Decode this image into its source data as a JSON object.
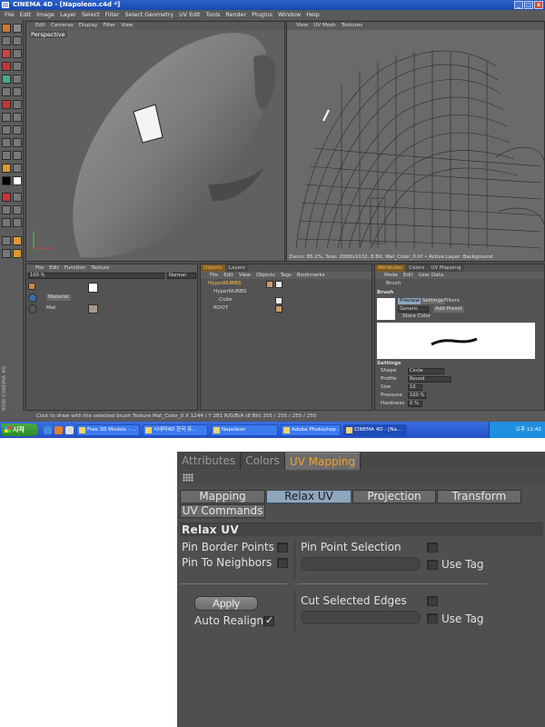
{
  "window": {
    "title": "CINEMA 4D - [Napoleon.c4d *]",
    "controls": [
      "_",
      "□",
      "x"
    ]
  },
  "menubar": [
    "File",
    "Edit",
    "Image",
    "Layer",
    "Select",
    "Filter",
    "Select Geometry",
    "UV Edit",
    "Tools",
    "Render",
    "Plugins",
    "Window",
    "Help"
  ],
  "viewport_left": {
    "menu": [
      "Edit",
      "Cameras",
      "Display",
      "Filter",
      "View"
    ],
    "label": "Perspective"
  },
  "viewport_right": {
    "menu": [
      "View",
      "UV Mesh",
      "Textures"
    ],
    "status": "Zoom: 85.2%, Size: 2080x1032, 8 Bit, Mat_Color_0.tif • Active Layer: Background"
  },
  "material_panel": {
    "menu": [
      "File",
      "Edit",
      "Function",
      "Texture"
    ],
    "zoom_value": "100 %",
    "blend_mode": "Normal",
    "materials": [
      "Material",
      "Mat"
    ]
  },
  "objects_panel": {
    "tabs": [
      "Objects",
      "Layers"
    ],
    "menu": [
      "File",
      "Edit",
      "View",
      "Objects",
      "Tags",
      "Bookmarks"
    ],
    "objects": [
      "HyperNURBS",
      "HyperNURBS",
      "Cube",
      "ROOT"
    ]
  },
  "attr_panel": {
    "tabs": [
      "Attributes",
      "Colors",
      "UV Mapping"
    ],
    "menu": [
      "Mode",
      "Edit",
      "User Data"
    ],
    "tool_name": "Brush",
    "section": "Brush",
    "preset_tabs": [
      "Preview",
      "Settings",
      "Filters"
    ],
    "preset_value": "Generic",
    "add_preset": "Add Preset",
    "store_color": "Store Color",
    "settings_header": "Settings",
    "shape_label": "Shape",
    "shape_value": "Circle",
    "profile_label": "Profile",
    "profile_value": "Round",
    "size_label": "Size",
    "size_value": "10",
    "pressure_label": "Pressure",
    "pressure_value": "100 %",
    "hardness_label": "Hardness",
    "hardness_value": "0 %"
  },
  "statusbar": {
    "text": "Click to draw with the selected brush  Texture Mat_Color_0   X 1244 / Y 281 R/G/B/A (8 Bit) 255 / 255 / 255 / 255"
  },
  "taskbar": {
    "start": "시작",
    "tasks": [
      "Free 3D Models - ...",
      "시네마4D 한국 유...",
      "Napoleon",
      "Adobe Photoshop ...",
      "CINEMA 4D - [Na..."
    ],
    "clock": "오후 12:42"
  },
  "uv_panel": {
    "tabs": [
      "Attributes",
      "Colors",
      "UV Mapping"
    ],
    "subtabs": [
      "Mapping",
      "Relax UV",
      "Projection",
      "Transform",
      "UV Commands"
    ],
    "section_title": "Relax UV",
    "pin_border_points": "Pin Border Points",
    "pin_to_neighbors": "Pin To Neighbors",
    "pin_point_selection": "Pin Point Selection",
    "use_tag_1": "Use Tag",
    "apply": "Apply",
    "auto_realign": "Auto Realign",
    "cut_selected_edges": "Cut Selected Edges",
    "use_tag_2": "Use Tag"
  }
}
